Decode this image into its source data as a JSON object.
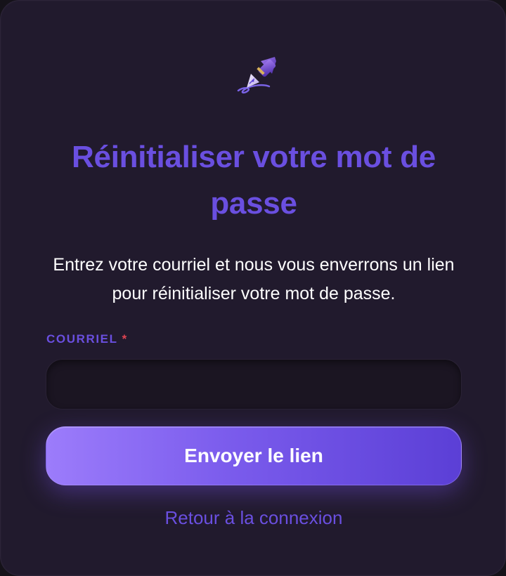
{
  "logo": {
    "icon": "fountain-pen-icon"
  },
  "header": {
    "title": "Réinitialiser votre mot de passe",
    "description": "Entrez votre courriel et nous vous enverrons un lien pour réinitialiser votre mot de passe."
  },
  "form": {
    "email_label": "COURRIEL",
    "required_marker": "*",
    "email_value": "",
    "submit_label": "Envoyer le lien"
  },
  "footer": {
    "back_link": "Retour à la connexion"
  },
  "colors": {
    "accent": "#6a4fe0",
    "card_background": "#211a2d",
    "required": "#e04452",
    "button_gradient_start": "#9c7cfb",
    "button_gradient_end": "#5b3fd6"
  }
}
